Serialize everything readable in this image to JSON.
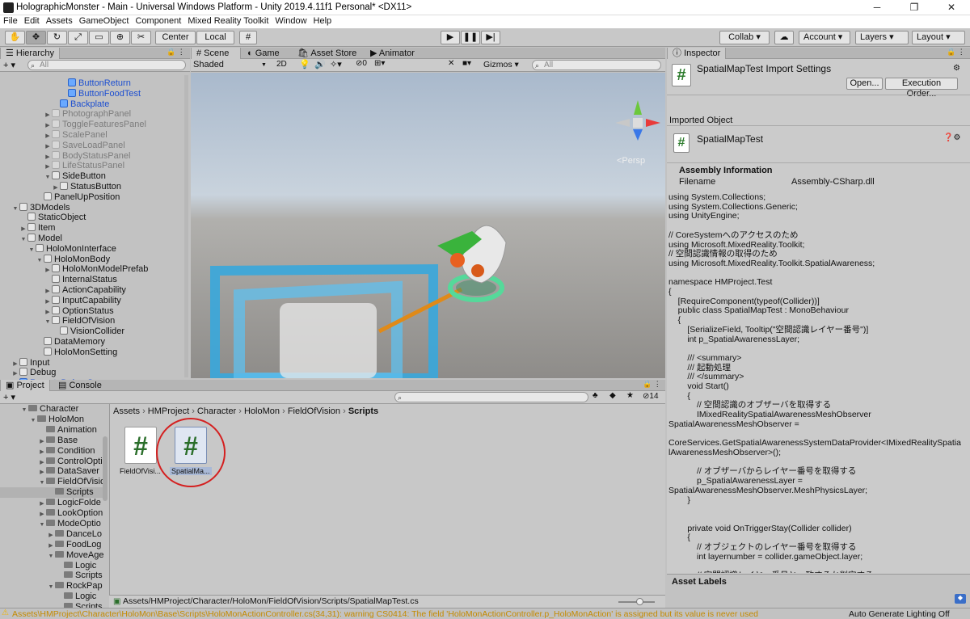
{
  "window": {
    "title": "HolographicMonster - Main - Universal Windows Platform - Unity 2019.4.11f1 Personal* <DX11>",
    "min": "─",
    "max": "❐",
    "close": "✕"
  },
  "menu": [
    "File",
    "Edit",
    "Assets",
    "GameObject",
    "Component",
    "Mixed Reality Toolkit",
    "Window",
    "Help"
  ],
  "toolbar": {
    "center": "Center",
    "local": "Local",
    "collab": "Collab ▾",
    "account": "Account",
    "layers": "Layers",
    "layout": "Layout"
  },
  "hierarchy": {
    "tab": "Hierarchy",
    "search_placeholder": "All",
    "add": "+ ▾",
    "rows": [
      {
        "t": "ButtonReturn",
        "d": 8,
        "s": "blue"
      },
      {
        "t": "ButtonFoodTest",
        "d": 8,
        "s": "blue"
      },
      {
        "t": "Backplate",
        "d": 7,
        "s": "blue"
      },
      {
        "t": "PhotographPanel",
        "d": 6,
        "s": "gray",
        "a": "▶"
      },
      {
        "t": "ToggleFeaturesPanel",
        "d": 6,
        "s": "gray",
        "a": "▶"
      },
      {
        "t": "ScalePanel",
        "d": 6,
        "s": "gray",
        "a": "▶"
      },
      {
        "t": "SaveLoadPanel",
        "d": 6,
        "s": "gray",
        "a": "▶"
      },
      {
        "t": "BodyStatusPanel",
        "d": 6,
        "s": "gray",
        "a": "▶"
      },
      {
        "t": "LifeStatusPanel",
        "d": 6,
        "s": "gray",
        "a": "▶"
      },
      {
        "t": "SideButton",
        "d": 6,
        "s": "",
        "a": "▼"
      },
      {
        "t": "StatusButton",
        "d": 7,
        "s": "",
        "a": "▶"
      },
      {
        "t": "PanelUpPosition",
        "d": 5,
        "s": ""
      },
      {
        "t": "3DModels",
        "d": 2,
        "s": "",
        "a": "▼"
      },
      {
        "t": "StaticObject",
        "d": 3,
        "s": ""
      },
      {
        "t": "Item",
        "d": 3,
        "s": "",
        "a": "▶"
      },
      {
        "t": "Model",
        "d": 3,
        "s": "",
        "a": "▼"
      },
      {
        "t": "HoloMonInterface",
        "d": 4,
        "s": "",
        "a": "▼"
      },
      {
        "t": "HoloMonBody",
        "d": 5,
        "s": "",
        "a": "▼"
      },
      {
        "t": "HoloMonModelPrefab",
        "d": 6,
        "s": "",
        "a": "▶"
      },
      {
        "t": "InternalStatus",
        "d": 6,
        "s": ""
      },
      {
        "t": "ActionCapability",
        "d": 6,
        "s": "",
        "a": "▶"
      },
      {
        "t": "InputCapability",
        "d": 6,
        "s": "",
        "a": "▶"
      },
      {
        "t": "OptionStatus",
        "d": 6,
        "s": "",
        "a": "▶"
      },
      {
        "t": "FieldOfVision",
        "d": 6,
        "s": "",
        "a": "▼"
      },
      {
        "t": "VisionCollider",
        "d": 7,
        "s": ""
      },
      {
        "t": "DataMemory",
        "d": 5,
        "s": ""
      },
      {
        "t": "HoloMonSetting",
        "d": 5,
        "s": ""
      },
      {
        "t": "Input",
        "d": 2,
        "s": "",
        "a": "▶"
      },
      {
        "t": "Debug",
        "d": 2,
        "s": "",
        "a": "▶"
      },
      {
        "t": "RemoteDebugServer",
        "d": 2,
        "s": "blue"
      }
    ]
  },
  "scene": {
    "tabs": [
      "# Scene",
      "Game",
      "Asset Store",
      "Animator"
    ],
    "shading": "Shaded",
    "twod": "2D",
    "gizmos": "Gizmos",
    "search_placeholder": "All",
    "persp": "<Persp",
    "fx_count": "0"
  },
  "project": {
    "tabs": [
      "Project",
      "Console"
    ],
    "add": "+ ▾",
    "count": "14",
    "breadcrumb": [
      "Assets",
      "HMProject",
      "Character",
      "HoloMon",
      "FieldOfVision",
      "Scripts"
    ],
    "tree": [
      {
        "t": "Character",
        "d": 1,
        "a": "▼"
      },
      {
        "t": "HoloMon",
        "d": 2,
        "a": "▼"
      },
      {
        "t": "Animation",
        "d": 3
      },
      {
        "t": "Base",
        "d": 3,
        "a": "▶"
      },
      {
        "t": "Condition",
        "d": 3,
        "a": "▶"
      },
      {
        "t": "ControlOpti",
        "d": 3,
        "a": "▶"
      },
      {
        "t": "DataSaver",
        "d": 3,
        "a": "▶"
      },
      {
        "t": "FieldOfVisio",
        "d": 3,
        "a": "▼"
      },
      {
        "t": "Scripts",
        "d": 4,
        "sel": true
      },
      {
        "t": "LogicFolde",
        "d": 3,
        "a": "▶"
      },
      {
        "t": "LookOption",
        "d": 3,
        "a": "▶"
      },
      {
        "t": "ModeOptio",
        "d": 3,
        "a": "▼"
      },
      {
        "t": "DanceLo",
        "d": 4,
        "a": "▶"
      },
      {
        "t": "FoodLog",
        "d": 4,
        "a": "▶"
      },
      {
        "t": "MoveAge",
        "d": 4,
        "a": "▼"
      },
      {
        "t": "Logic",
        "d": 5
      },
      {
        "t": "Scripts",
        "d": 5
      },
      {
        "t": "RockPap",
        "d": 4,
        "a": "▼"
      },
      {
        "t": "Logic",
        "d": 5
      },
      {
        "t": "Scripts",
        "d": 5
      }
    ],
    "files": [
      {
        "name": "FieldOfVisi...",
        "glyph": "#"
      },
      {
        "name": "SpatialMa...",
        "glyph": "#"
      }
    ],
    "path": "Assets/HMProject/Character/HoloMon/FieldOfVision/Scripts/SpatialMapTest.cs"
  },
  "inspector": {
    "tab": "Inspector",
    "header": "SpatialMapTest Import Settings",
    "open": "Open...",
    "exec": "Execution Order...",
    "imported_label": "Imported Object",
    "obj_name": "SpatialMapTest",
    "asm_title": "Assembly Information",
    "filename_label": "Filename",
    "filename_value": "Assembly-CSharp.dll",
    "asset_labels": "Asset Labels",
    "code": "using System.Collections;\nusing System.Collections.Generic;\nusing UnityEngine;\n\n// CoreSystemへのアクセスのため\nusing Microsoft.MixedReality.Toolkit;\n// 空間認識情報の取得のため\nusing Microsoft.MixedReality.Toolkit.SpatialAwareness;\n\nnamespace HMProject.Test\n{\n    [RequireComponent(typeof(Collider))]\n    public class SpatialMapTest : MonoBehaviour\n    {\n        [SerializeField, Tooltip(\"空間認識レイヤー番号\")]\n        int p_SpatialAwarenessLayer;\n\n        /// <summary>\n        /// 起動処理\n        /// </summary>\n        void Start()\n        {\n            // 空間認識のオブザーバを取得する\n            IMixedRealitySpatialAwarenessMeshObserver\nSpatialAwarenessMeshObserver =\n\nCoreServices.GetSpatialAwarenessSystemDataProvider<IMixedRealitySpatia\nlAwarenessMeshObserver>();\n\n            // オブザーバからレイヤー番号を取得する\n            p_SpatialAwarenessLayer =\nSpatialAwarenessMeshObserver.MeshPhysicsLayer;\n        }\n\n\n        private void OnTriggerStay(Collider collider)\n        {\n            // オブジェクトのレイヤー番号を取得する\n            int layernumber = collider.gameObject.layer;\n\n            // 空間認識レイヤー番号と一致するか判定する"
  },
  "status": {
    "warning": "Assets\\HMProject\\Character\\HoloMon\\Base\\Scripts\\HoloMonActionController.cs(34,31): warning CS0414: The field 'HoloMonActionController.p_HoloMonAction' is assigned but its value is never used",
    "lighting": "Auto Generate Lighting Off"
  },
  "colors": {
    "accent": "#1d4fd0",
    "warn": "#f0b400",
    "highlight": "#d42020"
  }
}
